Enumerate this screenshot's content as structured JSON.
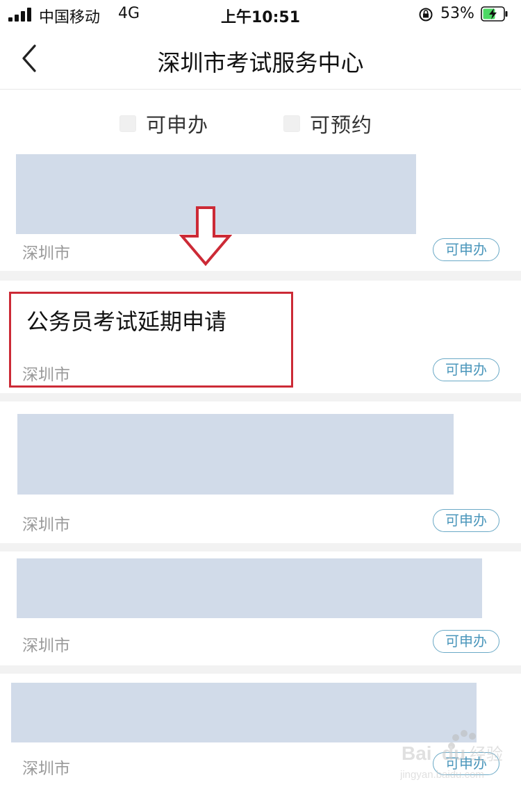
{
  "status_bar": {
    "carrier": "中国移动",
    "network": "4G",
    "time": "上午10:51",
    "battery": "53%"
  },
  "nav": {
    "title": "深圳市考试服务中心"
  },
  "filters": [
    {
      "label": "可申办",
      "checked": false
    },
    {
      "label": "可预约",
      "checked": false
    }
  ],
  "cards": [
    {
      "title": "",
      "city": "深圳市",
      "badge": "可申办",
      "blurred": true
    },
    {
      "title": "公务员考试延期申请",
      "city": "深圳市",
      "badge": "可申办",
      "blurred": false,
      "highlighted": true
    },
    {
      "title": "",
      "city": "深圳市",
      "badge": "可申办",
      "blurred": true
    },
    {
      "title": "",
      "city": "深圳市",
      "badge": "可申办",
      "blurred": true
    },
    {
      "title": "",
      "city": "深圳市",
      "badge": "可申办",
      "blurred": true
    }
  ],
  "colors": {
    "placeholder": "#d1dbe9",
    "badge": "#4a96bb",
    "highlight": "#cc2a36",
    "separator": "#f2f2f2"
  },
  "watermark": {
    "brand": "Baidu经验",
    "url": "jingyan.baidu.com"
  }
}
